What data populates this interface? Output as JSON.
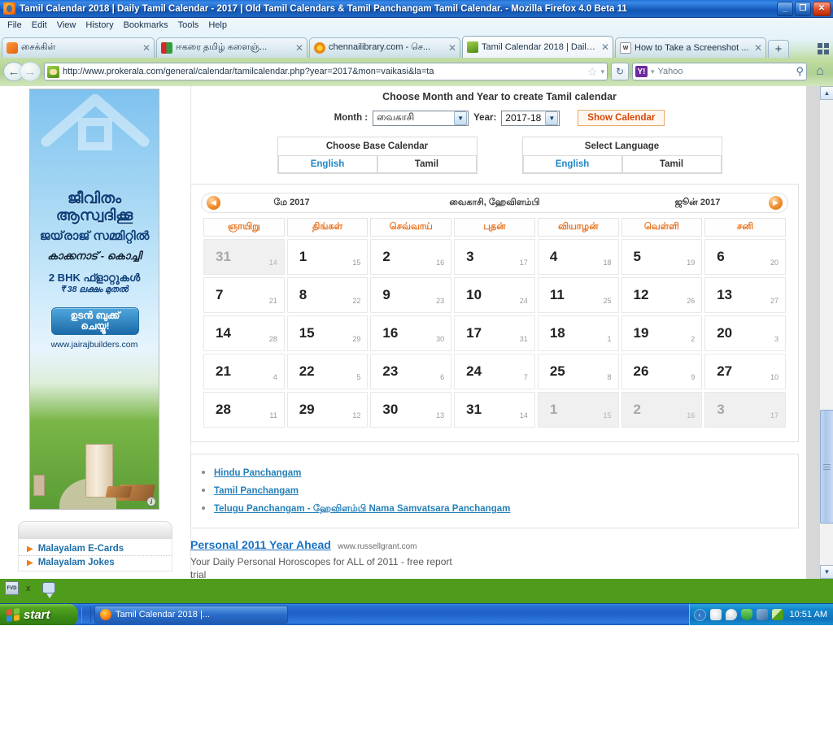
{
  "window": {
    "title": "Tamil Calendar 2018 | Daily Tamil Calendar - 2017 | Old Tamil Calendars & Tamil Panchangam Tamil Calendar. - Mozilla Firefox 4.0 Beta 11",
    "minimize_label": "_",
    "restore_label": "❐",
    "close_label": "✕"
  },
  "menubar": {
    "items": [
      "File",
      "Edit",
      "View",
      "History",
      "Bookmarks",
      "Tools",
      "Help"
    ]
  },
  "tabs": [
    {
      "label": "சைக்கிள்",
      "close": "✕",
      "active": false
    },
    {
      "label": "ஈகரை தமிழ் களைஞ்...",
      "close": "✕",
      "active": false
    },
    {
      "label": "chennailibrary.com - செ...",
      "close": "✕",
      "active": false
    },
    {
      "label": "Tamil Calendar 2018 | Daily ...",
      "close": "✕",
      "active": true
    },
    {
      "label": "How to Take a Screenshot ...",
      "close": "✕",
      "active": false
    }
  ],
  "tabbar": {
    "new_tab": "+"
  },
  "navbar": {
    "back": "←",
    "forward": "→",
    "url": "http://www.prokerala.com/general/calendar/tamilcalendar.php?year=2017&mon=vaikasi&la=ta",
    "bookmark_star": "☆",
    "star_caret": "▾",
    "reload": "↻",
    "search_engine": "Y!",
    "search_caret": "▾",
    "search_placeholder": "Yahoo",
    "search_go": "⚲",
    "home": "⌂"
  },
  "sidebar": {
    "ad": {
      "title_line1": "ജീവിതം",
      "title_line2": "ആസ്വദിക്കൂ",
      "subtitle": "ജയ്‌രാജ് സമ്മിറ്റിൽ",
      "location": "കാക്കനാട് - കൊച്ചി",
      "price_line1": "2 BHK ഫ്ളാറ്റുകൾ",
      "price_line2": "₹ 38 ലക്ഷം മുതൽ",
      "cta_line1": "ഉടൻ ബുക്ക്",
      "cta_line2": "ചെയ്യൂ!",
      "url": "www.jairajbuilders.com",
      "info_badge": "i"
    },
    "links": [
      {
        "arrow": "▶",
        "label": "Malayalam E-Cards"
      },
      {
        "arrow": "▶",
        "label": "Malayalam Jokes"
      }
    ]
  },
  "main": {
    "headline": "Choose Month and Year to create Tamil calendar",
    "month_label": "Month :",
    "month_value": "வைகாசி",
    "year_label": "Year:",
    "year_value": "2017-18",
    "show_button": "Show Calendar",
    "base_calendar": {
      "title": "Choose Base Calendar",
      "options": [
        "English",
        "Tamil"
      ],
      "selected": "English"
    },
    "language": {
      "title": "Select Language",
      "options": [
        "English",
        "Tamil"
      ],
      "selected": "English"
    },
    "calendar_nav": {
      "prev_icon": "◀",
      "prev_label": "மே 2017",
      "center_label": "வைகாசி, ஹேவிளம்பி",
      "next_label": "ஜூன் 2017",
      "next_icon": "▶"
    },
    "weekday_headers": [
      "ஞாயிறு",
      "திங்கள்",
      "செவ்வாய்",
      "புதன்",
      "வியாழன்",
      "வெள்ளி",
      "சனி"
    ],
    "calendar_weeks": [
      [
        {
          "day": "31",
          "sub": "14",
          "other": true
        },
        {
          "day": "1",
          "sub": "15",
          "other": false
        },
        {
          "day": "2",
          "sub": "16",
          "other": false
        },
        {
          "day": "3",
          "sub": "17",
          "other": false
        },
        {
          "day": "4",
          "sub": "18",
          "other": false
        },
        {
          "day": "5",
          "sub": "19",
          "other": false
        },
        {
          "day": "6",
          "sub": "20",
          "other": false
        }
      ],
      [
        {
          "day": "7",
          "sub": "21",
          "other": false
        },
        {
          "day": "8",
          "sub": "22",
          "other": false
        },
        {
          "day": "9",
          "sub": "23",
          "other": false
        },
        {
          "day": "10",
          "sub": "24",
          "other": false
        },
        {
          "day": "11",
          "sub": "25",
          "other": false
        },
        {
          "day": "12",
          "sub": "26",
          "other": false
        },
        {
          "day": "13",
          "sub": "27",
          "other": false
        }
      ],
      [
        {
          "day": "14",
          "sub": "28",
          "other": false
        },
        {
          "day": "15",
          "sub": "29",
          "other": false
        },
        {
          "day": "16",
          "sub": "30",
          "other": false
        },
        {
          "day": "17",
          "sub": "31",
          "other": false
        },
        {
          "day": "18",
          "sub": "1",
          "other": false
        },
        {
          "day": "19",
          "sub": "2",
          "other": false
        },
        {
          "day": "20",
          "sub": "3",
          "other": false
        }
      ],
      [
        {
          "day": "21",
          "sub": "4",
          "other": false
        },
        {
          "day": "22",
          "sub": "5",
          "other": false
        },
        {
          "day": "23",
          "sub": "6",
          "other": false
        },
        {
          "day": "24",
          "sub": "7",
          "other": false
        },
        {
          "day": "25",
          "sub": "8",
          "other": false
        },
        {
          "day": "26",
          "sub": "9",
          "other": false
        },
        {
          "day": "27",
          "sub": "10",
          "other": false
        }
      ],
      [
        {
          "day": "28",
          "sub": "11",
          "other": false
        },
        {
          "day": "29",
          "sub": "12",
          "other": false
        },
        {
          "day": "30",
          "sub": "13",
          "other": false
        },
        {
          "day": "31",
          "sub": "14",
          "other": false
        },
        {
          "day": "1",
          "sub": "15",
          "other": true
        },
        {
          "day": "2",
          "sub": "16",
          "other": true
        },
        {
          "day": "3",
          "sub": "17",
          "other": true
        }
      ]
    ],
    "panchangam_links": [
      "Hindu Panchangam",
      "Tamil Panchangam",
      "Telugu Panchangam - ஹேவிளம்பி Nama Samvatsara Panchangam"
    ],
    "ad": {
      "title": "Personal 2011 Year Ahead",
      "url": "www.russellgrant.com",
      "description": "Your Daily Personal Horoscopes for ALL of 2011 - free report trial"
    }
  },
  "scrollbar": {
    "up": "▲",
    "down": "▼"
  },
  "taskbar": {
    "start_label": "start",
    "task_label": "Tamil Calendar 2018 |...",
    "tray_chevron": "‹",
    "time": "10:51 AM"
  },
  "desktop": {
    "icon_label": "FVD",
    "x_label": "x"
  },
  "colors": {
    "accent_orange": "#e8701a",
    "link_blue": "#2580b8",
    "titlebar_blue": "#1257b8",
    "desktop_green": "#4f9c1c"
  }
}
